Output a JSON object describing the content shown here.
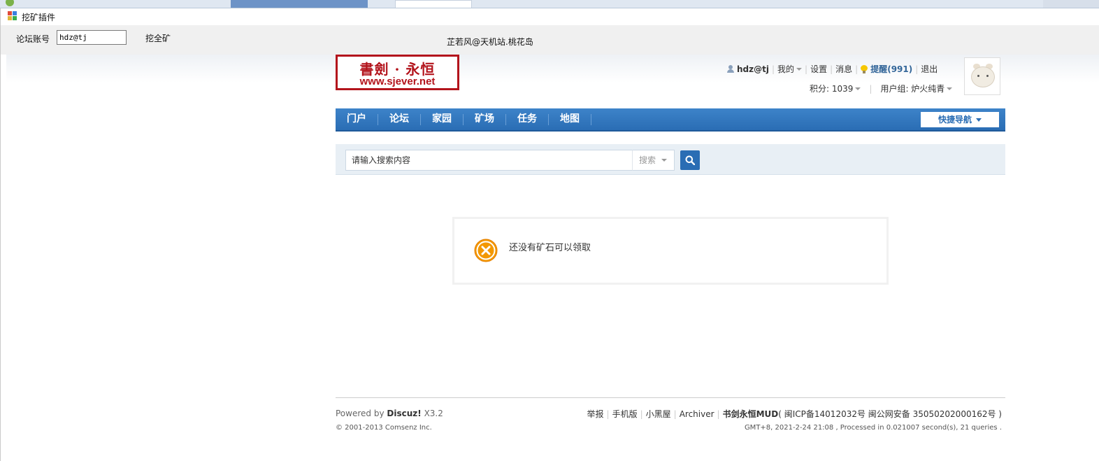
{
  "window": {
    "title": "挖矿插件"
  },
  "toolbar": {
    "account_label": "论坛账号",
    "account_value": "hdz@tj",
    "dig_all_label": "挖全矿",
    "status_text": "芷若风@天机站.桃花岛"
  },
  "forum": {
    "logo_main": "書劍 · 永恒",
    "logo_url": "www.sjever.net",
    "user": {
      "username": "hdz@tj",
      "my_label": "我的",
      "settings_label": "设置",
      "messages_label": "消息",
      "remind_label": "提醒(991)",
      "logout_label": "退出",
      "points_label": "积分: 1039",
      "group_label": "用户组: 炉火纯青"
    },
    "nav": {
      "items": [
        "门户",
        "论坛",
        "家园",
        "矿场",
        "任务",
        "地图"
      ],
      "quick_nav_label": "快捷导航"
    },
    "search": {
      "placeholder": "请输入搜索内容",
      "type_label": "搜索"
    },
    "message": {
      "text": "还没有矿石可以领取"
    },
    "footer": {
      "powered_prefix": "Powered by",
      "powered_brand": "Discuz!",
      "powered_version": "X3.2",
      "copyright": "© 2001-2013 Comsenz Inc.",
      "links": [
        "举报",
        "手机版",
        "小黑屋",
        "Archiver"
      ],
      "site_name": "书剑永恒MUD",
      "icp": "( 闽ICP备14012032号 闽公网安备 35050202000162号 )",
      "stats": "GMT+8, 2021-2-24 21:08 , Processed in 0.021007 second(s), 21 queries ."
    }
  },
  "colors": {
    "nav_blue": "#2a6db4",
    "logo_red": "#b3141c",
    "error_orange": "#f39800"
  }
}
